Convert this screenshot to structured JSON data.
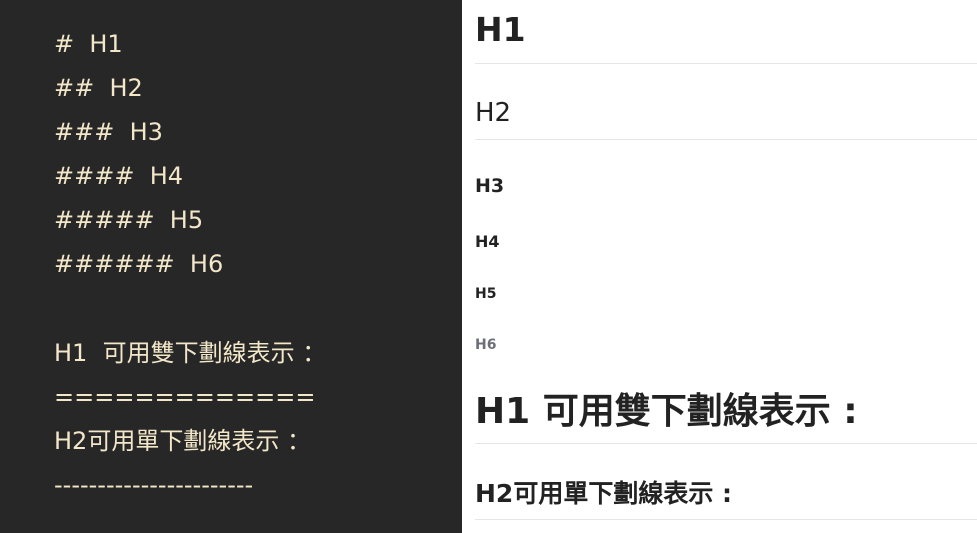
{
  "editor": {
    "lines": [
      "#  H1",
      "##  H2",
      "###  H3",
      "####  H4",
      "#####  H5",
      "######  H6",
      "H1  可用雙下劃線表示 ：",
      "=============",
      "H2可用單下劃線表示 ：",
      "-----------------------"
    ]
  },
  "preview": {
    "h1": "H1",
    "h2": "H2",
    "h3": "H3",
    "h4": "H4",
    "h5": "H5",
    "h6": "H6",
    "setext_h1": {
      "lat": "H1",
      "cjk": " 可用雙下劃線表示 :"
    },
    "setext_h2": {
      "lat": "H2",
      "cjk": "可用單下劃線表示 :"
    }
  },
  "colors": {
    "editor_bg": "#272727",
    "editor_text": "#f3e7c9",
    "preview_text": "#222222",
    "h6_text": "#6b6f78",
    "rule": "#e6e6e6"
  }
}
